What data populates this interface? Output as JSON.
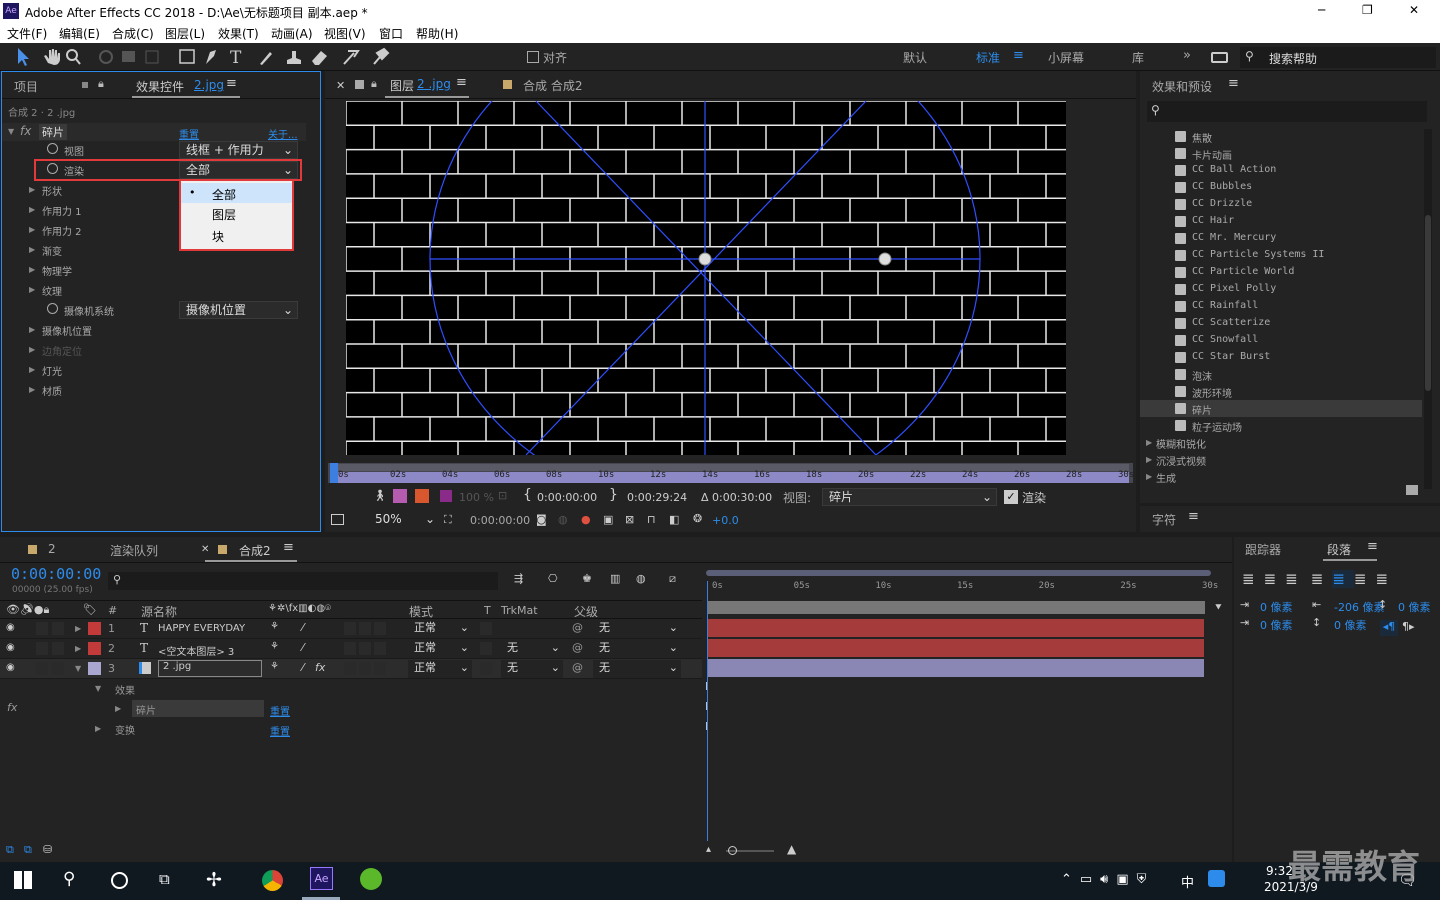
{
  "window": {
    "app_icon": "Ae",
    "title": "Adobe After Effects CC 2018 - D:\\Ae\\无标题项目 副本.aep *",
    "minimize": "─",
    "maximize": "❐",
    "close": "✕"
  },
  "menu": [
    "文件(F)",
    "编辑(E)",
    "合成(C)",
    "图层(L)",
    "效果(T)",
    "动画(A)",
    "视图(V)",
    "窗口",
    "帮助(H)"
  ],
  "toolbar": {
    "align_label": "对齐",
    "workspaces": [
      "默认",
      "标准",
      "小屏幕",
      "库"
    ],
    "active_workspace": "标准",
    "search_placeholder": "搜索帮助",
    "more": "»"
  },
  "left_panel": {
    "tab_project": "项目",
    "tab_effects": "效果控件",
    "tab_effects_link": "2.jpg",
    "breadcrumb": "合成 2 · 2 .jpg",
    "effect_name": "碎片",
    "reset": "重置",
    "about": "关于...",
    "props": [
      {
        "label": "视图",
        "value": "线框 + 作用力",
        "kind": "dropdown",
        "stopwatch": true
      },
      {
        "label": "渲染",
        "value": "全部",
        "kind": "dropdown",
        "stopwatch": true,
        "highlight": true
      },
      {
        "label": "形状",
        "kind": "group"
      },
      {
        "label": "作用力 1",
        "kind": "group"
      },
      {
        "label": "作用力 2",
        "kind": "group"
      },
      {
        "label": "渐变",
        "kind": "group"
      },
      {
        "label": "物理学",
        "kind": "group"
      },
      {
        "label": "纹理",
        "kind": "group"
      },
      {
        "label": "摄像机系统",
        "value": "摄像机位置",
        "kind": "dropdown",
        "stopwatch": true
      },
      {
        "label": "摄像机位置",
        "kind": "group"
      },
      {
        "label": "边角定位",
        "kind": "group",
        "disabled": true
      },
      {
        "label": "灯光",
        "kind": "group"
      },
      {
        "label": "材质",
        "kind": "group"
      }
    ],
    "render_menu": {
      "options": [
        "全部",
        "图层",
        "块"
      ],
      "selected": "全部"
    }
  },
  "viewer": {
    "tab_layer": "图层",
    "tab_layer_link": "2 .jpg",
    "tab_comp": "合成 合成2",
    "ruler": [
      "0s",
      "02s",
      "04s",
      "06s",
      "08s",
      "10s",
      "12s",
      "14s",
      "16s",
      "18s",
      "20s",
      "22s",
      "24s",
      "26s",
      "28s",
      "30s"
    ],
    "opacity": "100 %",
    "time_in": "0:00:00:00",
    "time_out": "0:00:29:24",
    "duration": "Δ 0:00:30:00",
    "view_label": "视图:",
    "view_value": "碎片",
    "render_label": "渲染",
    "zoom": "50%",
    "current_time": "0:00:00:00",
    "exposure": "+0.0"
  },
  "effects_panel": {
    "title": "效果和预设",
    "search_placeholder": "",
    "items": [
      "焦散",
      "卡片动画",
      "CC Ball Action",
      "CC Bubbles",
      "CC Drizzle",
      "CC Hair",
      "CC Mr. Mercury",
      "CC Particle Systems II",
      "CC Particle World",
      "CC Pixel Polly",
      "CC Rainfall",
      "CC Scatterize",
      "CC Snowfall",
      "CC Star Burst",
      "泡沫",
      "波形环境",
      "碎片",
      "粒子运动场"
    ],
    "selected": "碎片",
    "groups": [
      "模糊和锐化",
      "沉浸式视频",
      "生成"
    ],
    "char_title": "字符"
  },
  "timeline": {
    "tabs": [
      "2",
      "渲染队列",
      "合成2"
    ],
    "active_tab": "合成2",
    "timecode": "0:00:00:00",
    "fps": "00000 (25.00 fps)",
    "columns": {
      "num": "#",
      "source": "源名称",
      "mode": "模式",
      "t": "T",
      "trkmat": "TrkMat",
      "parent": "父级"
    },
    "layers": [
      {
        "num": "1",
        "type": "T",
        "name": "HAPPY EVERYDAY",
        "mode": "正常",
        "trkmat": "",
        "parent": "无",
        "color": "#c23a3a"
      },
      {
        "num": "2",
        "type": "T",
        "name": "<空文本图层> 3",
        "mode": "正常",
        "trkmat": "无",
        "parent": "无",
        "color": "#c23a3a"
      },
      {
        "num": "3",
        "type": "img",
        "name": "2 .jpg",
        "mode": "正常",
        "trkmat": "无",
        "parent": "无",
        "color": "#a9a6cf"
      }
    ],
    "sub_effects": "效果",
    "sub_shatter": "碎片",
    "sub_reset": "重置",
    "sub_transform": "变换",
    "sub_reset2": "重置",
    "ruler": [
      "0s",
      "05s",
      "10s",
      "15s",
      "20s",
      "25s",
      "30s"
    ]
  },
  "right_panel": {
    "tab_tracker": "跟踪器",
    "tab_paragraph": "段落",
    "indent_left": "0 像素",
    "indent_right": "0 像素",
    "space_before": "-206 像素",
    "space_after": "0 像素",
    "first_line": "0 像素"
  },
  "taskbar": {
    "time": "9:32",
    "date": "2021/3/9",
    "ime": "中",
    "watermark": "最需教育"
  },
  "colors": {
    "accent": "#2d8ceb",
    "layer_red": "#c23a3a",
    "layer_purple": "#a9a6cf",
    "highlight_box": "#e23a3a"
  }
}
